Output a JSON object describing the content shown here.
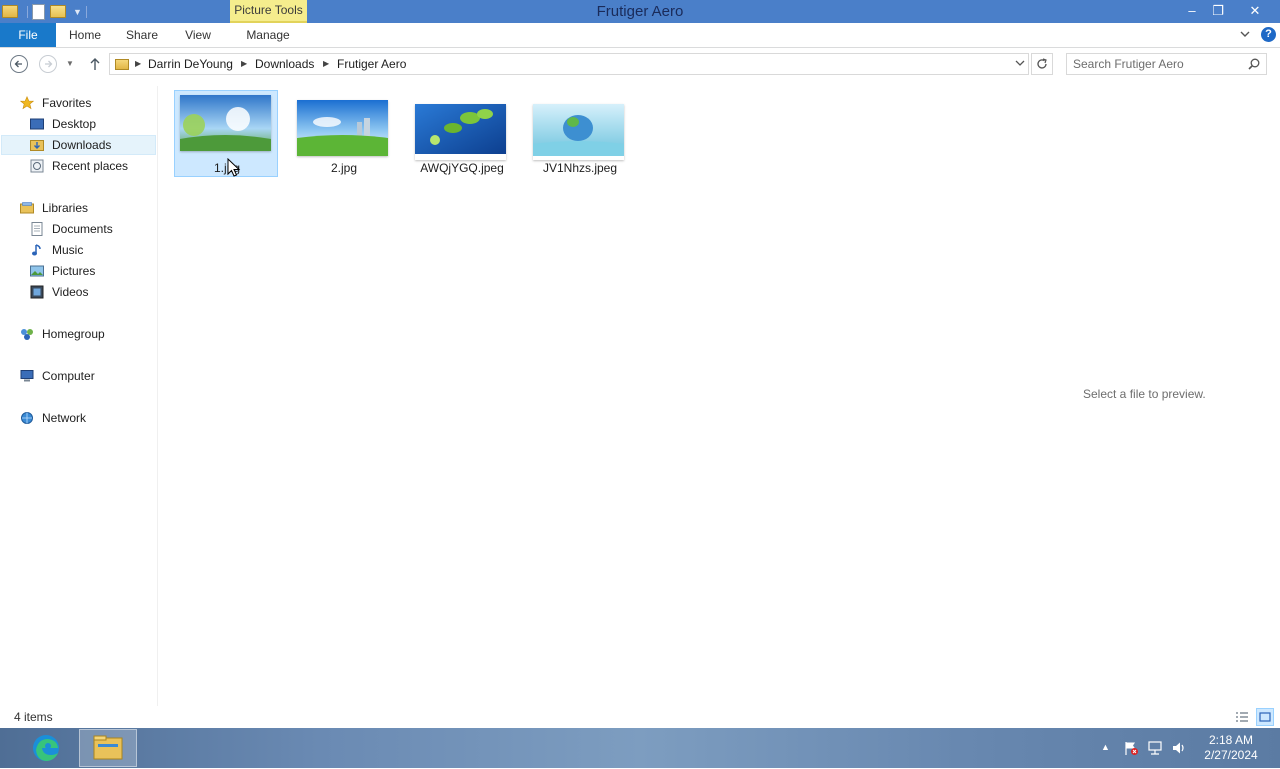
{
  "window": {
    "title": "Frutiger Aero",
    "contextual_tab": "Picture Tools",
    "controls": {
      "minimize": "‒",
      "maximize": "❐",
      "close": "✕"
    }
  },
  "ribbon": {
    "tabs": [
      "File",
      "Home",
      "Share",
      "View",
      "Manage"
    ],
    "help": "?"
  },
  "navigation": {
    "breadcrumb": [
      "Darrin DeYoung",
      "Downloads",
      "Frutiger Aero"
    ],
    "search_placeholder": "Search Frutiger Aero"
  },
  "sidebar": {
    "favorites": {
      "label": "Favorites",
      "items": [
        "Desktop",
        "Downloads",
        "Recent places"
      ],
      "selected": "Downloads"
    },
    "libraries": {
      "label": "Libraries",
      "items": [
        "Documents",
        "Music",
        "Pictures",
        "Videos"
      ]
    },
    "homegroup": "Homegroup",
    "computer": "Computer",
    "network": "Network"
  },
  "files": [
    {
      "name": "1.jpg",
      "selected": true
    },
    {
      "name": "2.jpg",
      "selected": false
    },
    {
      "name": "AWQjYGQ.jpeg",
      "selected": false
    },
    {
      "name": "JV1Nhzs.jpeg",
      "selected": false
    }
  ],
  "preview_pane": {
    "message": "Select a file to preview."
  },
  "status": {
    "item_count": "4 items"
  },
  "taskbar": {
    "time": "2:18 AM",
    "date": "2/27/2024"
  },
  "colors": {
    "titlebar": "#4a7fc9",
    "file_tab": "#1979ca",
    "contextual_tab": "#f5ed8d",
    "selection": "#cde8ff",
    "selection_border": "#99d1ff"
  }
}
